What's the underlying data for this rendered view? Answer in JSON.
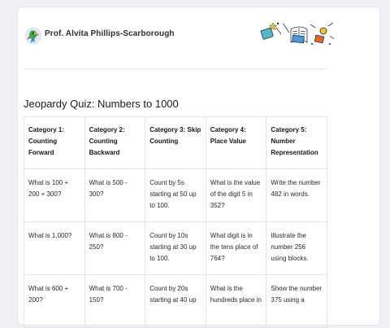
{
  "author": {
    "name": "Prof. Alvita Phillips-Scarborough",
    "avatar_icon": "parrot-icon"
  },
  "decoration": {
    "icon": "school-supplies-doodle"
  },
  "quiz": {
    "title": "Jeopardy Quiz: Numbers to 1000",
    "headers": [
      "Category 1: Counting Forward",
      "Category 2: Counting Backward",
      "Category 3: Skip Counting",
      "Category 4: Place Value",
      "Category 5: Number Representation"
    ],
    "rows": [
      [
        "What is 100 + 200 + 300?",
        "What is 500 - 300?",
        "Count by 5s starting at 50 up to 100.",
        "What is the value of the digit 5 in 352?",
        "Write the number 482 in words."
      ],
      [
        "What is 1,000?",
        "What is 800 - 250?",
        "Count by 10s starting at 30 up to 100.",
        "What digit is in the tens place of 764?",
        "Illustrate the number 256 using blocks."
      ],
      [
        "What is 600 + 200?",
        "What is 700 - 150?",
        "Count by 20s starting at 40 up",
        "What is the hundreds place in",
        "Show the number 375 using a"
      ]
    ]
  },
  "colors": {
    "page_bg": "#eef0f3",
    "sheet_bg": "#ffffff",
    "grid": "#e0e3e8",
    "text": "#232833"
  }
}
